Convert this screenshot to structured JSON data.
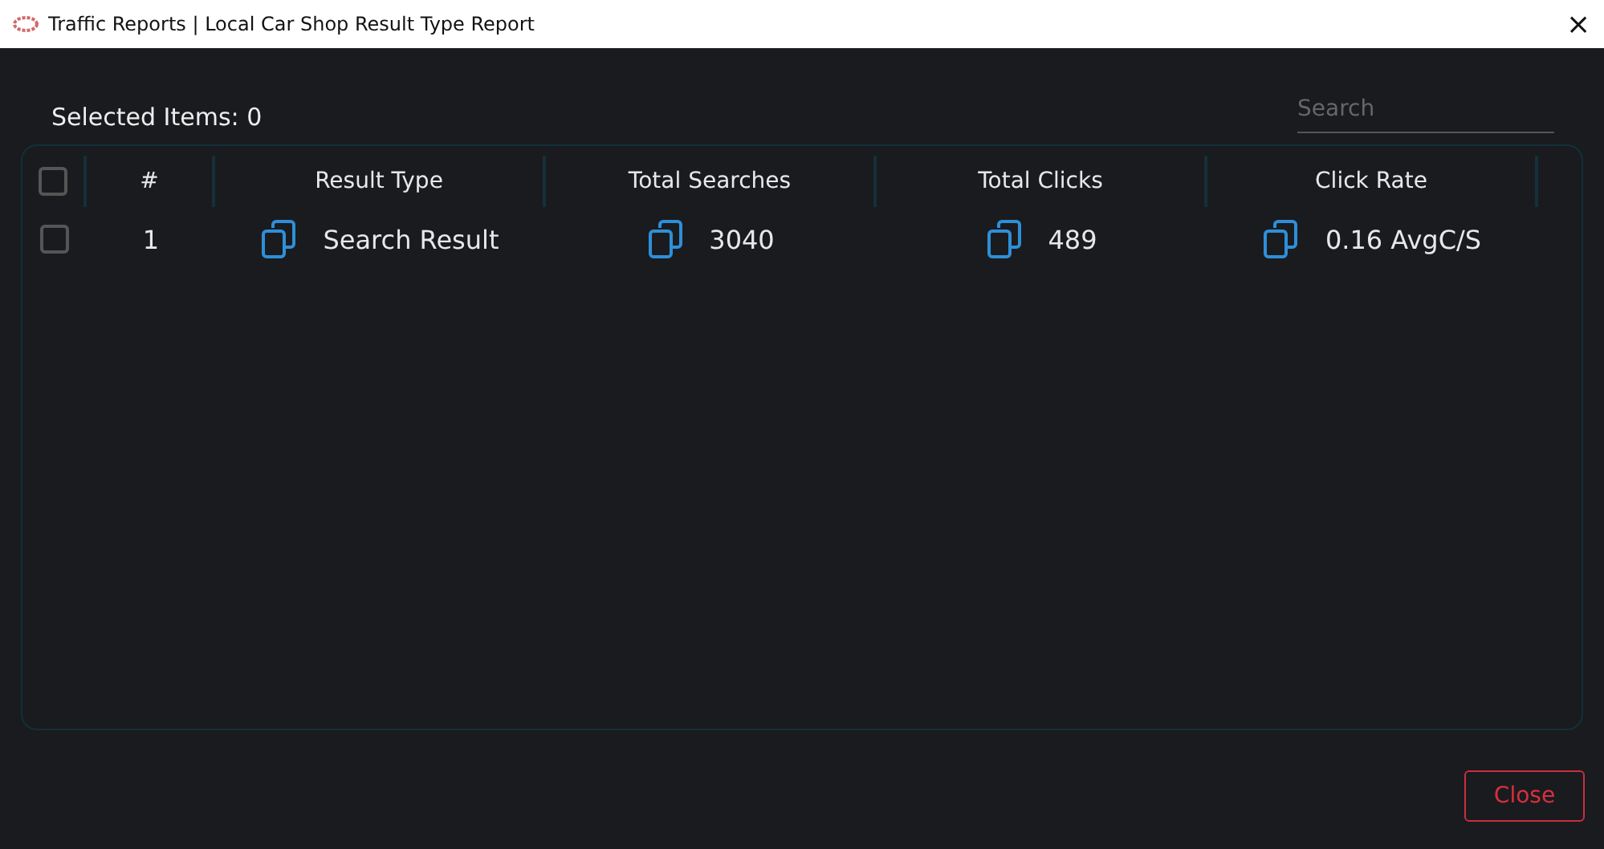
{
  "window": {
    "title": "Traffic Reports | Local Car Shop Result Type Report",
    "close_glyph": "×"
  },
  "selected_label": "Selected Items: 0",
  "search": {
    "placeholder": "Search"
  },
  "table": {
    "select_all": {
      "checked": false
    },
    "columns": [
      "#",
      "Result Type",
      "Total Searches",
      "Total Clicks",
      "Click Rate"
    ],
    "rows": [
      {
        "checked": false,
        "cells": [
          "1",
          "Search Result",
          "3040",
          "489",
          "0.16 AvgC/S"
        ]
      }
    ]
  },
  "buttons": [
    {
      "label": "Close",
      "kind": "danger"
    }
  ]
}
